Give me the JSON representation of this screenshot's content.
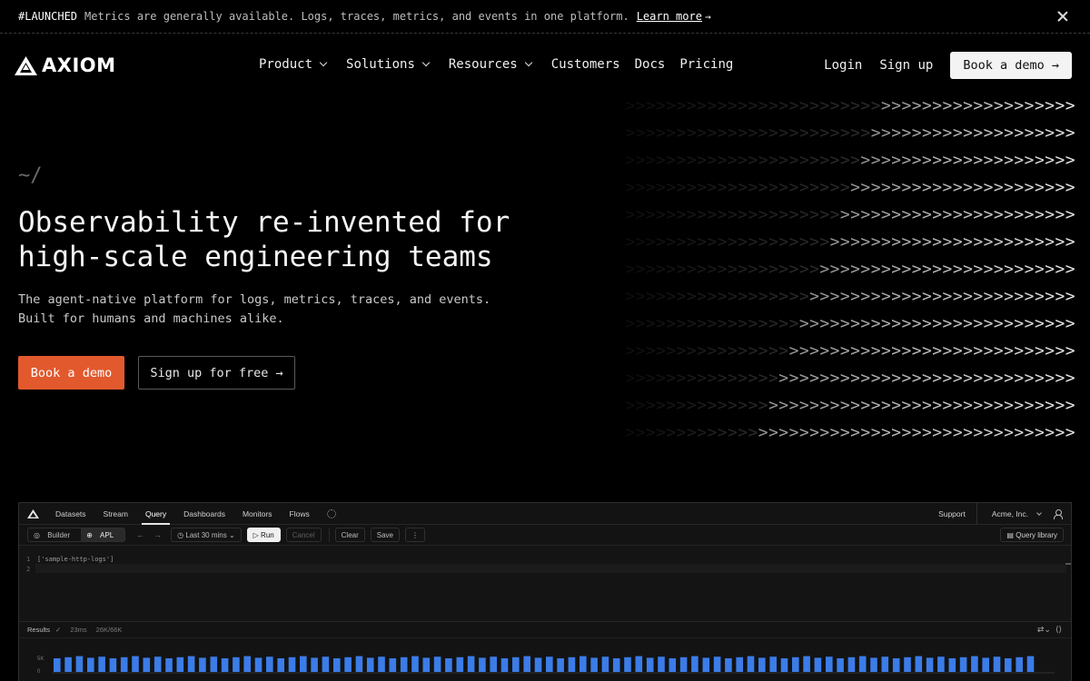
{
  "banner": {
    "tag": "#LAUNCHED",
    "message": "Metrics are generally available. Logs, traces, metrics, and events in one platform.",
    "link": "Learn more",
    "arrow": "→"
  },
  "nav": {
    "logo_text": "AXIOM",
    "items": [
      {
        "label": "Product",
        "dropdown": true
      },
      {
        "label": "Solutions",
        "dropdown": true
      },
      {
        "label": "Resources",
        "dropdown": true
      },
      {
        "label": "Customers",
        "dropdown": false
      },
      {
        "label": "Docs",
        "dropdown": false
      },
      {
        "label": "Pricing",
        "dropdown": false
      }
    ],
    "login": "Login",
    "signup": "Sign up",
    "demo": "Book a demo →"
  },
  "hero": {
    "prompt": "~/",
    "headline_1": "Observability re-invented for",
    "headline_2": "high-scale engineering teams",
    "sub_1": "The agent-native platform for logs, metrics, traces, and events.",
    "sub_2": "Built for humans and machines alike.",
    "primary_cta": "Book a demo",
    "secondary_cta": "Sign up for free →"
  },
  "decor": {
    "chevron_rows": 13,
    "bright_counts": [
      19,
      20,
      21,
      22,
      23,
      24,
      25,
      26,
      27,
      28,
      29,
      30,
      31
    ],
    "total_chars": 44,
    "glyph": ">"
  },
  "app": {
    "tabs": [
      "Datasets",
      "Stream",
      "Query",
      "Dashboards",
      "Monitors",
      "Flows"
    ],
    "active_tab": "Query",
    "support": "Support",
    "org": "Acme, Inc.",
    "mode_builder": "Builder",
    "mode_apl": "APL",
    "time_range": "Last 30 mins",
    "run": "Run",
    "cancel": "Cancel",
    "clear": "Clear",
    "save": "Save",
    "more": "⋮",
    "query_library": "Query library",
    "editor_lines": [
      {
        "num": "1",
        "text": "['sample-http-logs']"
      },
      {
        "num": "2",
        "text": ""
      }
    ],
    "results_label": "Results",
    "results_time": "23ms",
    "results_count": "26K/66K",
    "chart_ylabels": [
      "5K",
      "0"
    ],
    "chart_bar_color": "#3b7ce8",
    "chart_bar_count": 88
  }
}
